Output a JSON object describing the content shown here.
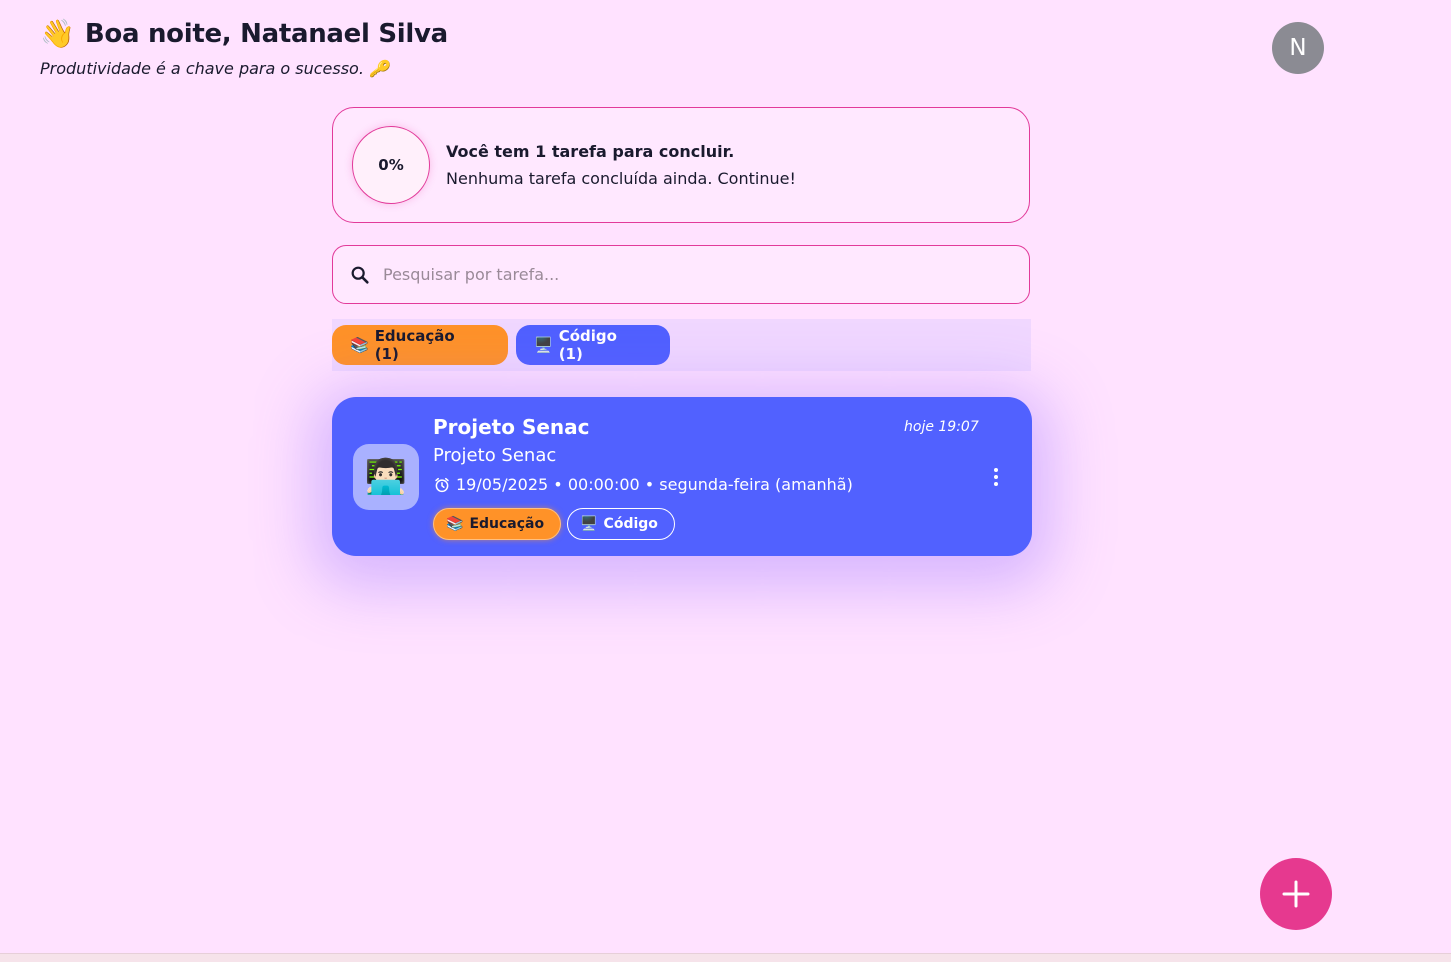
{
  "header": {
    "wave_emoji": "👋",
    "greeting": "Boa noite, Natanael Silva",
    "subtitle": "Produtividade é a chave para o sucesso. 🔑",
    "avatar_initial": "N",
    "avatar_color": "#8b8b93"
  },
  "progress": {
    "percent_label": "0%",
    "percent_value": 0,
    "title": "Você tem 1 tarefa para concluir.",
    "message": "Nenhuma tarefa concluída ainda. Continue!"
  },
  "search": {
    "placeholder": "Pesquisar por tarefa...",
    "value": "",
    "icon": "search-icon"
  },
  "filters": [
    {
      "emoji": "📚",
      "label": "Educação (1)",
      "color": "#ff9228"
    },
    {
      "emoji": "🖥️",
      "label": "Código (1)",
      "color": "#5060ff"
    }
  ],
  "task": {
    "avatar_emoji": "👨🏻‍💻",
    "title": "Projeto Senac",
    "created": "hoje 19:07",
    "description": "Projeto Senac",
    "due": "19/05/2025 • 00:00:00 • segunda-feira (amanhã)",
    "due_icon": "alarm-clock-icon",
    "card_color": "#5161ff",
    "tags": [
      {
        "emoji": "📚",
        "label": "Educação"
      },
      {
        "emoji": "🖥️",
        "label": "Código"
      }
    ],
    "menu_icon": "more-vertical-icon"
  },
  "fab": {
    "icon": "plus-icon",
    "color": "#e6398f"
  },
  "colors": {
    "background": "#ffe2ff",
    "accent": "#e23a9a"
  }
}
